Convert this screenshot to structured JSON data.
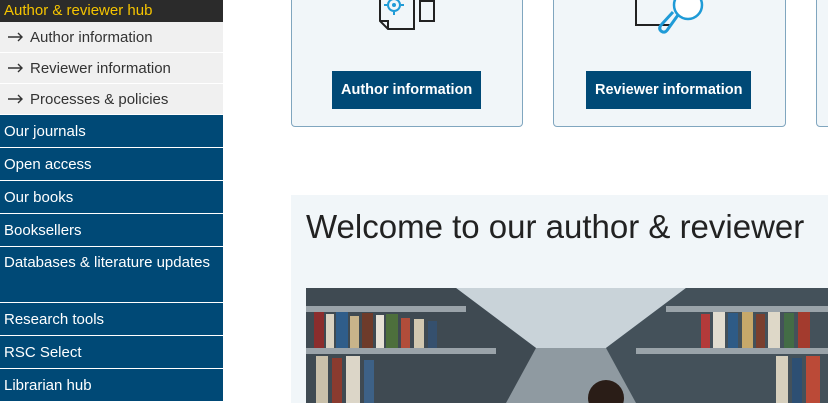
{
  "sidebar": {
    "header": "Author & reviewer hub",
    "sub_items": [
      {
        "label": "Author information"
      },
      {
        "label": "Reviewer information"
      },
      {
        "label": "Processes & policies"
      }
    ],
    "items": [
      {
        "label": "Our journals"
      },
      {
        "label": "Open access"
      },
      {
        "label": "Our books"
      },
      {
        "label": "Booksellers"
      },
      {
        "label": "Databases & literature updates"
      },
      {
        "label": "Research tools"
      },
      {
        "label": "RSC Select"
      },
      {
        "label": "Librarian hub"
      }
    ]
  },
  "cards": [
    {
      "button_label": "Author information",
      "icon": "document-gear-icon"
    },
    {
      "button_label": "Reviewer information",
      "icon": "magnifier-review-icon"
    }
  ],
  "welcome": {
    "title": "Welcome to our author & reviewer"
  },
  "colors": {
    "brand_blue": "#004976",
    "header_yellow": "#f5c400",
    "header_dark": "#2b2b2b",
    "panel_bg": "#f1f6f9"
  }
}
